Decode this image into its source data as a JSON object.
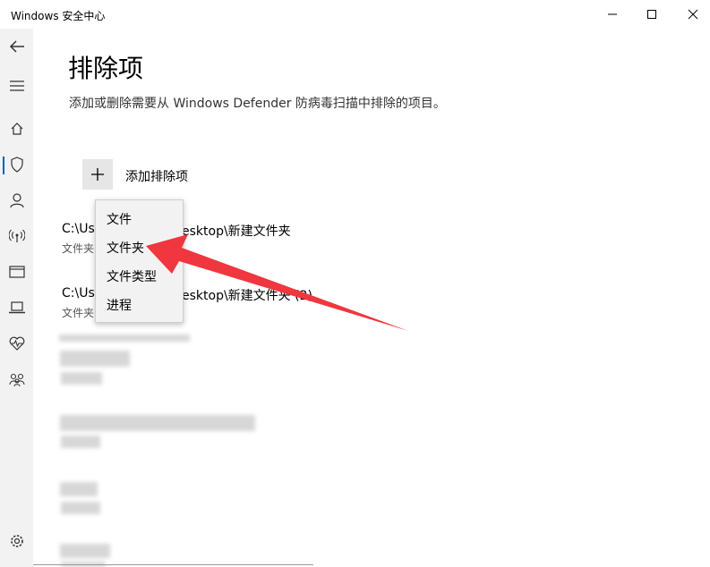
{
  "window": {
    "title": "Windows 安全中心"
  },
  "page": {
    "title": "排除项",
    "description": "添加或删除需要从 Windows Defender 防病毒扫描中排除的项目。",
    "add_label": "添加排除项"
  },
  "exclusions": [
    {
      "path_start": "C:\\Use",
      "path_end": "esktop\\新建文件夹",
      "type": "文件夹"
    },
    {
      "path_start": "C:\\Use",
      "path_end": "esktop\\新建文件夹 (2)",
      "type": "文件夹"
    }
  ],
  "menu": {
    "items": [
      "文件",
      "文件夹",
      "文件类型",
      "进程"
    ]
  },
  "colors": {
    "accent": "#0063b1",
    "arrow": "#f0363e"
  },
  "sidebar_icons": [
    "back-arrow-icon",
    "menu-icon",
    "home-icon",
    "shield-icon",
    "account-icon",
    "firewall-network-icon",
    "app-browser-control-icon",
    "device-security-icon",
    "device-health-icon",
    "family-options-icon",
    "settings-icon"
  ]
}
